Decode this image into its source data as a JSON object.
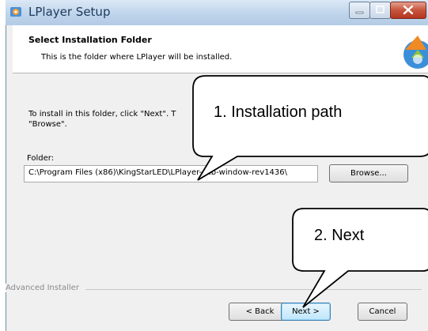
{
  "window": {
    "title": "LPlayer Setup"
  },
  "header": {
    "title": "Select Installation Folder",
    "subtitle": "This is the folder where LPlayer will be installed."
  },
  "body": {
    "hint": "To install in this folder, click \"Next\". T\n\"Browse\".",
    "folder_label": "Folder:",
    "folder_path": "C:\\Program Files (x86)\\KingStarLED\\LPlayer-sub-window-rev1436\\",
    "browse_label": "Browse..."
  },
  "footer": {
    "installer_label": "Advanced Installer",
    "back_label": "< Back",
    "next_label": "Next >",
    "cancel_label": "Cancel"
  },
  "annotations": {
    "callout1": "1. Installation path",
    "callout2": "2. Next"
  },
  "icons": {
    "app": "installer-app-icon",
    "header": "installer-logo-icon",
    "minimize": "minimize-icon",
    "maximize": "maximize-icon",
    "close": "close-icon"
  },
  "colors": {
    "titlebar": "#bcd3ea",
    "close_button": "#c7533b",
    "next_button_focus": "#3c7fb1"
  }
}
